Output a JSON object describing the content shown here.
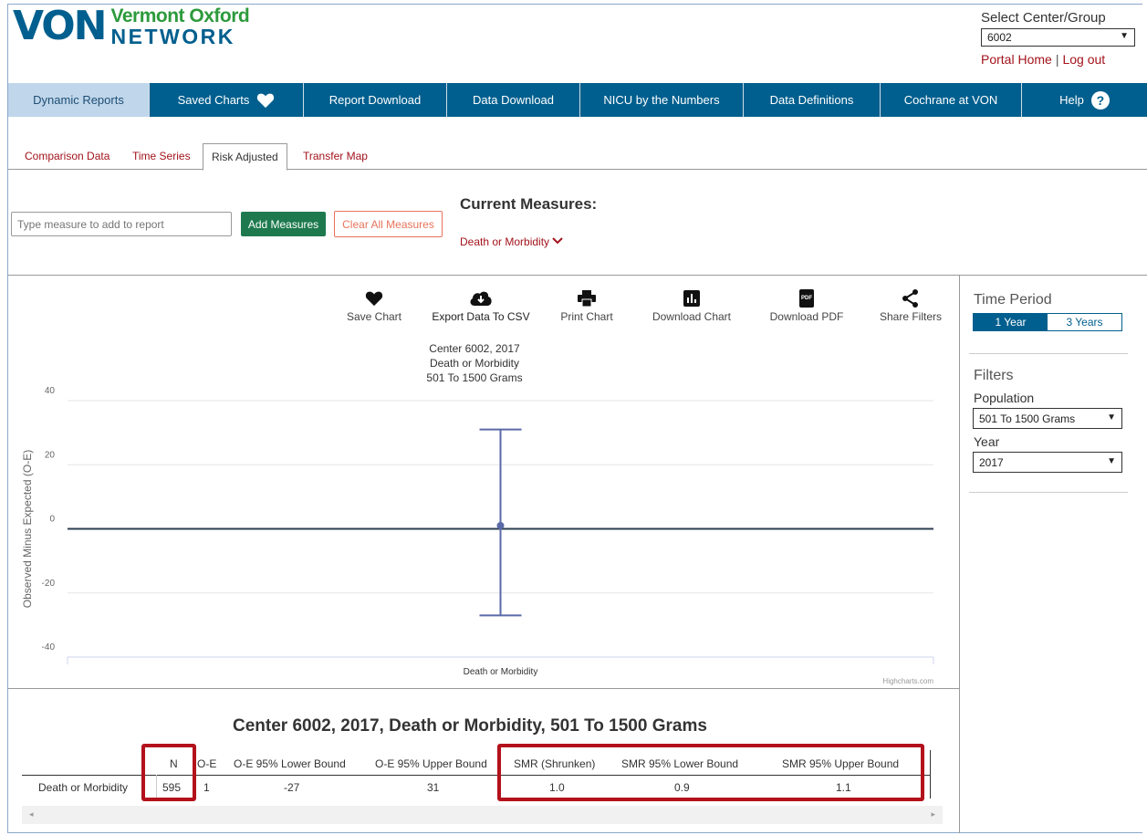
{
  "header": {
    "logo_letters": "VON",
    "logo_line1": "Vermont Oxford",
    "logo_line2": "NETWORK",
    "select_label": "Select Center/Group",
    "center_value": "6002",
    "portal_home": "Portal Home",
    "separator": "|",
    "logout": "Log out"
  },
  "nav": {
    "items": [
      {
        "label": "Dynamic Reports"
      },
      {
        "label": "Saved Charts"
      },
      {
        "label": "Report Download"
      },
      {
        "label": "Data Download"
      },
      {
        "label": "NICU by the Numbers"
      },
      {
        "label": "Data Definitions"
      },
      {
        "label": "Cochrane at VON"
      },
      {
        "label": "Help"
      }
    ],
    "help_glyph": "?"
  },
  "tabs": [
    {
      "label": "Comparison Data"
    },
    {
      "label": "Time Series"
    },
    {
      "label": "Risk Adjusted"
    },
    {
      "label": "Transfer Map"
    }
  ],
  "measures": {
    "input_placeholder": "Type measure to add to report",
    "add_label": "Add Measures",
    "clear_label": "Clear All Measures",
    "current_title": "Current Measures:",
    "current_item": "Death or Morbidity"
  },
  "toolbar": {
    "save": "Save Chart",
    "export": "Export Data To CSV",
    "print": "Print Chart",
    "download_chart": "Download Chart",
    "download_pdf": "Download PDF",
    "share": "Share Filters",
    "pdf_badge": "PDF"
  },
  "chart_data": {
    "type": "errorbar",
    "title_lines": [
      "Center 6002, 2017",
      "Death or Morbidity",
      "501 To 1500 Grams"
    ],
    "ylabel": "Observed Minus Expected (O-E)",
    "categories": [
      "Death or Morbidity"
    ],
    "ylim": [
      -40,
      40
    ],
    "yticks": [
      "40",
      "20",
      "0",
      "-20",
      "-40"
    ],
    "point": {
      "category": "Death or Morbidity",
      "value": 1,
      "lower": -27,
      "upper": 31
    },
    "credit": "Highcharts.com",
    "colors": {
      "series": "#5a6aa8",
      "zero_line": "#2c3e50"
    }
  },
  "right_panel": {
    "time_period_title": "Time Period",
    "period_options": [
      "1 Year",
      "3 Years"
    ],
    "selected_period": "1 Year",
    "filters_title": "Filters",
    "population_label": "Population",
    "population_value": "501 To 1500 Grams",
    "year_label": "Year",
    "year_value": "2017"
  },
  "table": {
    "title": "Center 6002, 2017, Death or Morbidity, 501 To 1500 Grams",
    "headers": [
      "N",
      "O-E",
      "O-E 95% Lower Bound",
      "O-E 95% Upper Bound",
      "SMR (Shrunken)",
      "SMR 95% Lower Bound",
      "SMR 95% Upper Bound"
    ],
    "row_label": "Death or Morbidity",
    "row": [
      "595",
      "1",
      "-27",
      "31",
      "1.0",
      "0.9",
      "1.1"
    ],
    "scroll_left": "◂",
    "scroll_right": "▸"
  },
  "colors": {
    "brand_blue": "#005f8e",
    "brand_green": "#2d9a3c",
    "link_red": "#a3131c",
    "highlight_red": "#b3111b",
    "add_green": "#1e7a4e",
    "clear_orange": "#e8745c"
  }
}
